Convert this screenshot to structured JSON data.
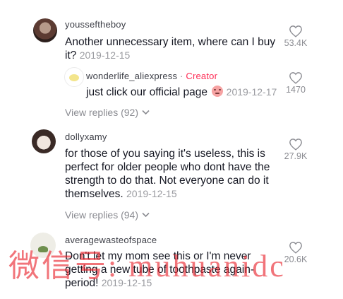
{
  "comments": [
    {
      "username": "yousseftheboy",
      "text": "Another unnecessary item, where can I buy it?",
      "date": "2019-12-15",
      "likes": "53.4K",
      "view_replies": "View replies (92)",
      "reply": {
        "username": "wonderlife_aliexpress",
        "separator": "·",
        "badge": "Creator",
        "text": "just click our official page",
        "date": "2019-12-17",
        "likes": "1470"
      }
    },
    {
      "username": "dollyxamy",
      "text": "for those of you saying it's useless, this is perfect for older people who dont have the strength to do that. Not everyone can do it themselves.",
      "date": "2019-12-15",
      "likes": "27.9K",
      "view_replies": "View replies (94)"
    },
    {
      "username": "averagewasteofspace",
      "text": "Don't let my mom see this or I'm never getting a new tube of toothpaste again- period!",
      "date": "2019-12-15",
      "likes": "20.6K"
    }
  ],
  "watermark": "微信号: muhuanidc",
  "colors": {
    "creator": "#fe2c55",
    "muted": "#8a8b91",
    "watermark": "#e81e28"
  },
  "icons": [
    "heart-outline-icon",
    "chevron-down-icon",
    "blush-emoji-icon"
  ]
}
